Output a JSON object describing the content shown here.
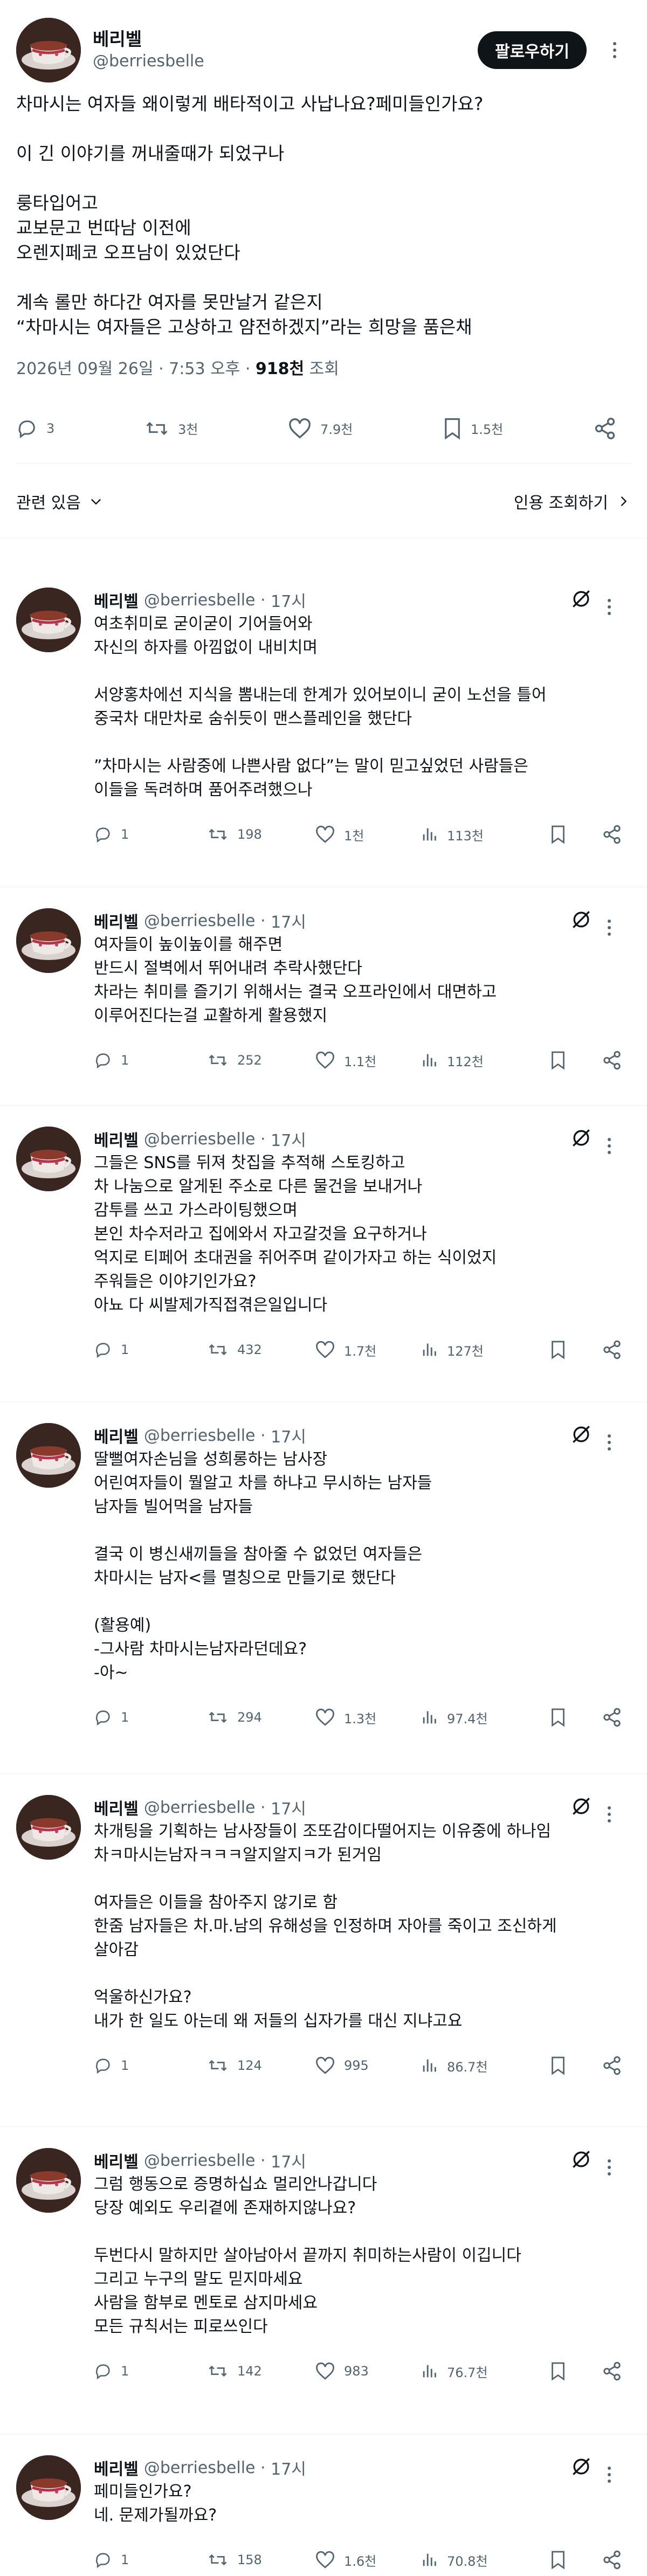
{
  "author": {
    "name": "베리벨",
    "handle": "@berriesbelle"
  },
  "follow_label": "팔로우하기",
  "main_post": {
    "text": "차마시는 여자들 왜이렇게 배타적이고 사납나요?페미들인가요?\n\n이 긴 이야기를 꺼내줄때가 되었구나\n\n룽타입어고\n교보문고 번따남 이전에\n오렌지페코 오프남이 있었단다\n\n계속 롤만 하다간 여자를 못만날거 같은지\n“차마시는 여자들은 고상하고 얌전하겠지”라는 희망을 품은채",
    "date": "2026년 09월 26일 · 7:53 오후 · ",
    "views": "918천",
    "views_label": " 조회",
    "replies": "3",
    "reposts": "3천",
    "likes": "7.9천",
    "bookmarks": "1.5천"
  },
  "related": {
    "left": "관련 있음",
    "right": "인용 조회하기"
  },
  "replies": [
    {
      "time": "17시",
      "text": "여초취미로 굳이굳이 기어들어와\n자신의 하자를 아낌없이 내비치며\n\n서양홍차에선 지식을 뽐내는데 한계가 있어보이니 굳이 노선을 틀어\n중국차 대만차로 숨쉬듯이 맨스플레인을 했단다\n\n”차마시는 사람중에 나쁜사람 없다”는 말이 믿고싶었던 사람들은\n이들을 독려하며 품어주려했으나",
      "replies": "1",
      "reposts": "198",
      "likes": "1천",
      "views": "113천"
    },
    {
      "time": "17시",
      "text": "여자들이 높이높이를 해주면\n반드시 절벽에서 뛰어내려 추락사했단다\n차라는 취미를 즐기기 위해서는 결국 오프라인에서 대면하고\n이루어진다는걸 교활하게 활용했지",
      "replies": "1",
      "reposts": "252",
      "likes": "1.1천",
      "views": "112천"
    },
    {
      "time": "17시",
      "text": "그들은 SNS를 뒤져 찻집을 추적해 스토킹하고\n차 나눔으로 알게된 주소로 다른 물건을 보내거나\n감투를 쓰고 가스라이팅했으며\n본인 차수저라고 집에와서 자고갈것을 요구하거나\n억지로 티페어 초대권을 쥐어주며 같이가자고 하는 식이었지\n주워들은 이야기인가요?\n아뇨 다 씨발제가직접겪은일입니다",
      "replies": "1",
      "reposts": "432",
      "likes": "1.7천",
      "views": "127천"
    },
    {
      "time": "17시",
      "text": "딸뻘여자손님을 성희롱하는 남사장\n어린여자들이 뭘알고 차를 하냐고 무시하는 남자들\n남자들 빌어먹을 남자들\n\n결국 이 병신새끼들을 참아줄 수 없었던 여자들은\n차마시는 남자<를 멸칭으로 만들기로 했단다\n\n(활용예)\n-그사람 차마시는남자라던데요?\n-아~",
      "replies": "1",
      "reposts": "294",
      "likes": "1.3천",
      "views": "97.4천"
    },
    {
      "time": "17시",
      "text": "차개팅을 기획하는 남사장들이 조또감이다떨어지는 이유중에 하나임\n차ㅋ마시는남자ㅋㅋㅋ알지알지ㅋ가 된거임\n\n여자들은 이들을 참아주지 않기로 함\n한줌 남자들은 차.마.남의 유해성을 인정하며 자아를 죽이고 조신하게\n살아감\n\n억울하신가요?\n내가 한 일도 아는데 왜 저들의 십자가를 대신 지냐고요",
      "replies": "1",
      "reposts": "124",
      "likes": "995",
      "views": "86.7천"
    },
    {
      "time": "17시",
      "text": "그럼 행동으로 증명하십쇼 멀리안나갑니다\n당장 예외도 우리곁에 존재하지않나요?\n\n두번다시 말하지만 살아남아서 끝까지 취미하는사람이 이깁니다\n그리고 누구의 말도 믿지마세요\n사람을 함부로 멘토로 삼지마세요\n모든 규칙서는 피로쓰인다",
      "replies": "1",
      "reposts": "142",
      "likes": "983",
      "views": "76.7천"
    },
    {
      "time": "17시",
      "text": "페미들인가요?\n네. 문제가될까요?",
      "replies": "1",
      "reposts": "158",
      "likes": "1.6천",
      "views": "70.8천"
    }
  ]
}
